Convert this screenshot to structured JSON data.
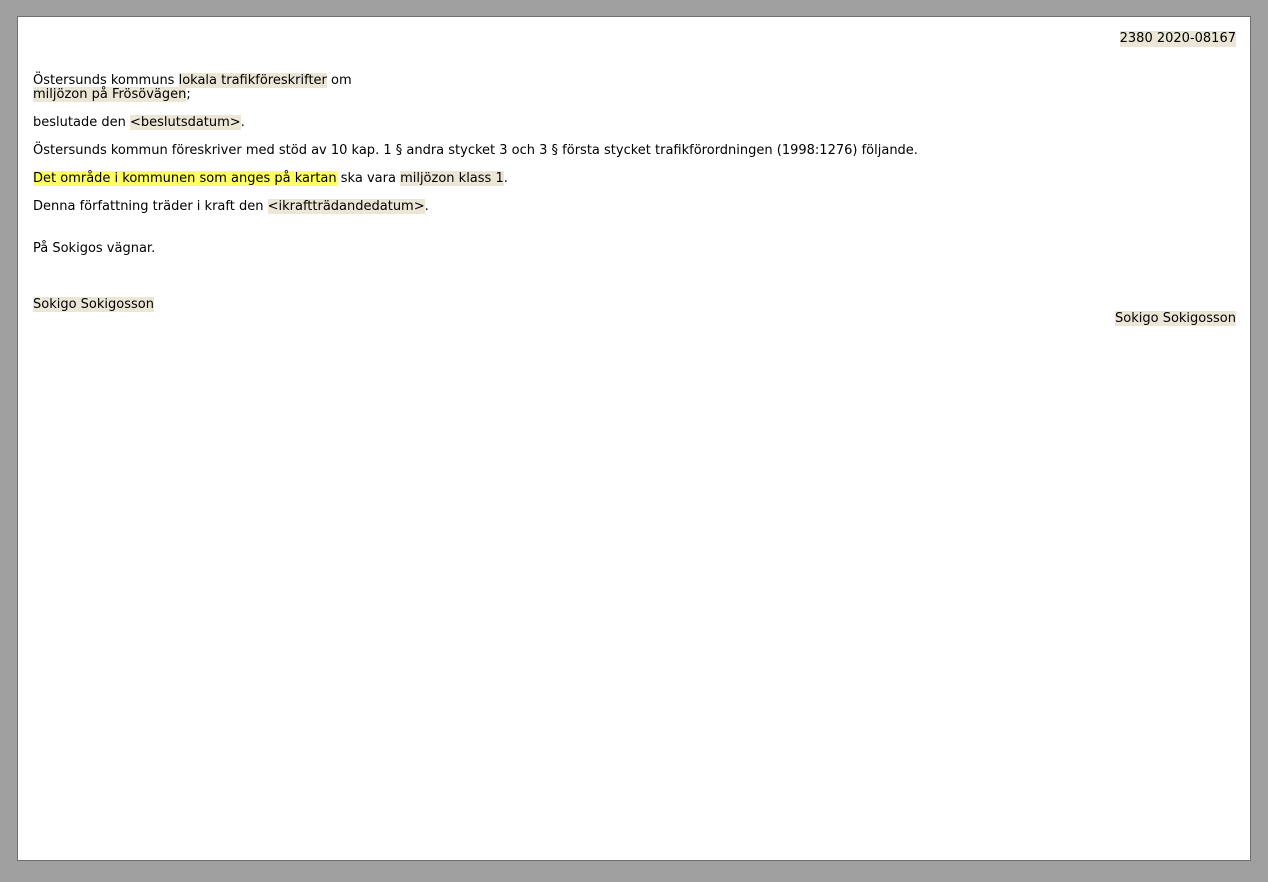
{
  "document": {
    "ref_number": "2380 2020-08167",
    "title": {
      "prefix": "Östersunds kommuns ",
      "field1": "lokala trafikföreskrifter",
      "mid": " om",
      "field2": "miljözon på Frösövägen",
      "suffix": ";"
    },
    "decided": {
      "prefix": "beslutade den ",
      "field": "<beslutsdatum>",
      "suffix": "."
    },
    "authority_text": "Östersunds kommun föreskriver med stöd av 10 kap. 1 § andra stycket 3 och 3 § första stycket trafikförordningen (1998:1276) följande.",
    "rule": {
      "highlight": "Det område i kommunen som anges på kartan",
      "mid": " ska vara ",
      "field": "miljözon klass 1",
      "suffix": "."
    },
    "effective": {
      "prefix": "Denna författning träder i kraft den ",
      "field": "<ikraftträdandedatum>",
      "suffix": "."
    },
    "on_behalf": "På Sokigos vägnar.",
    "signatory_left": "Sokigo Sokigosson",
    "signatory_right": "Sokigo Sokigosson"
  },
  "colors": {
    "field_background": "#ece6d6",
    "highlight_background": "#ffff66",
    "workspace_background": "#a0a0a0"
  }
}
